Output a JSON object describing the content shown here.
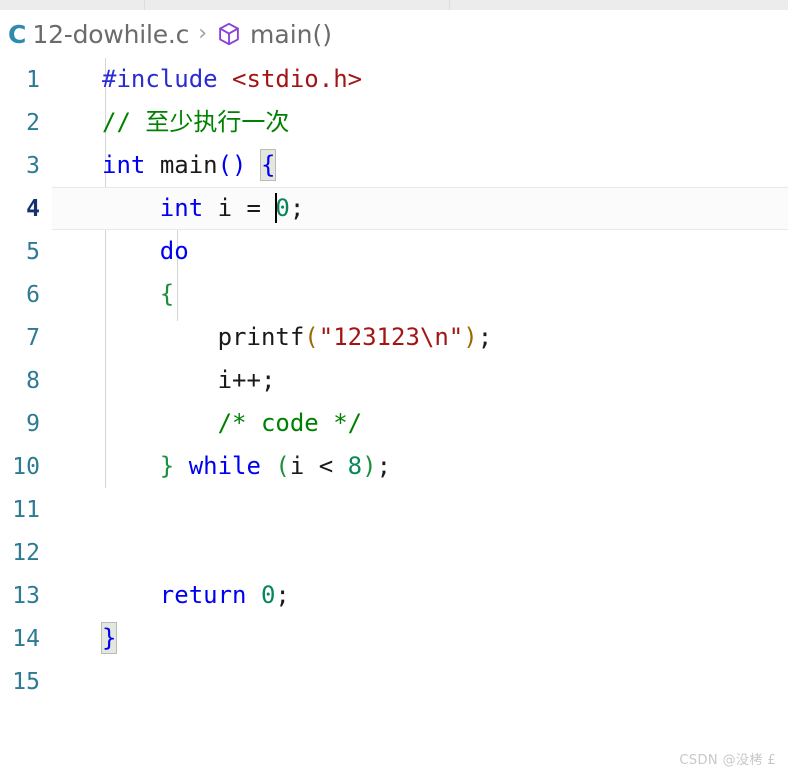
{
  "window": {
    "tab_strip_segments": [
      "",
      "",
      ""
    ]
  },
  "breadcrumb": {
    "language_badge": "C",
    "file_name": "12-dowhile.c",
    "separator": "›",
    "symbol_icon": "cube-icon",
    "symbol_name": "main()"
  },
  "editor": {
    "active_line": 4,
    "cursor_line": 4,
    "cursor_column": 13,
    "colors": {
      "keyword": "#0000f0",
      "preprocessor": "#2b2bd4",
      "string": "#a31515",
      "comment": "#008000",
      "number": "#098658",
      "brace_green": "#1a8f3c",
      "paren_gold": "#9a6a00",
      "line_number": "#2c7a94",
      "active_line_number": "#16306f",
      "background": "#ffffff",
      "active_line_background": "#fbfbfb",
      "indent_guide": "#d6d6d6",
      "bracket_match_background": "#e4e6e0"
    },
    "line_numbers": [
      "1",
      "2",
      "3",
      "4",
      "5",
      "6",
      "7",
      "8",
      "9",
      "10",
      "11",
      "12",
      "13",
      "14",
      "15"
    ],
    "lines": [
      {
        "n": "1",
        "text": "#include <stdio.h>"
      },
      {
        "n": "2",
        "text": "// 至少执行一次"
      },
      {
        "n": "3",
        "text": "int main() {"
      },
      {
        "n": "4",
        "text": "    int i = 0;"
      },
      {
        "n": "5",
        "text": "    do"
      },
      {
        "n": "6",
        "text": "    {"
      },
      {
        "n": "7",
        "text": "        printf(\"123123\\n\");"
      },
      {
        "n": "8",
        "text": "        i++;"
      },
      {
        "n": "9",
        "text": "        /* code */"
      },
      {
        "n": "10",
        "text": "    } while (i < 8);"
      },
      {
        "n": "11",
        "text": ""
      },
      {
        "n": "12",
        "text": ""
      },
      {
        "n": "13",
        "text": "    return 0;"
      },
      {
        "n": "14",
        "text": "}"
      },
      {
        "n": "15",
        "text": ""
      }
    ],
    "tokens": {
      "l1_include": "#include",
      "l1_header": "<stdio.h>",
      "l2_comment": "// 至少执行一次",
      "l3_int": "int",
      "l3_main": "main",
      "l3_parens": "()",
      "l3_brace": "{",
      "l4_int": "int",
      "l4_i": "i",
      "l4_eq": "=",
      "l4_zero": "0",
      "l4_semi": ";",
      "l5_do": "do",
      "l6_brace": "{",
      "l7_printf": "printf",
      "l7_open": "(",
      "l7_string": "\"123123\\n\"",
      "l7_close": ")",
      "l7_semi": ";",
      "l8_stmt": "i++;",
      "l9_comment": "/* code */",
      "l10_brace": "}",
      "l10_while": "while",
      "l10_open": "(",
      "l10_i": "i",
      "l10_lt": "<",
      "l10_eight": "8",
      "l10_close": ")",
      "l10_semi": ";",
      "l13_return": "return",
      "l13_zero": "0",
      "l13_semi": ";",
      "l14_brace": "}"
    }
  },
  "watermark": {
    "text": "CSDN @没栲 £"
  }
}
